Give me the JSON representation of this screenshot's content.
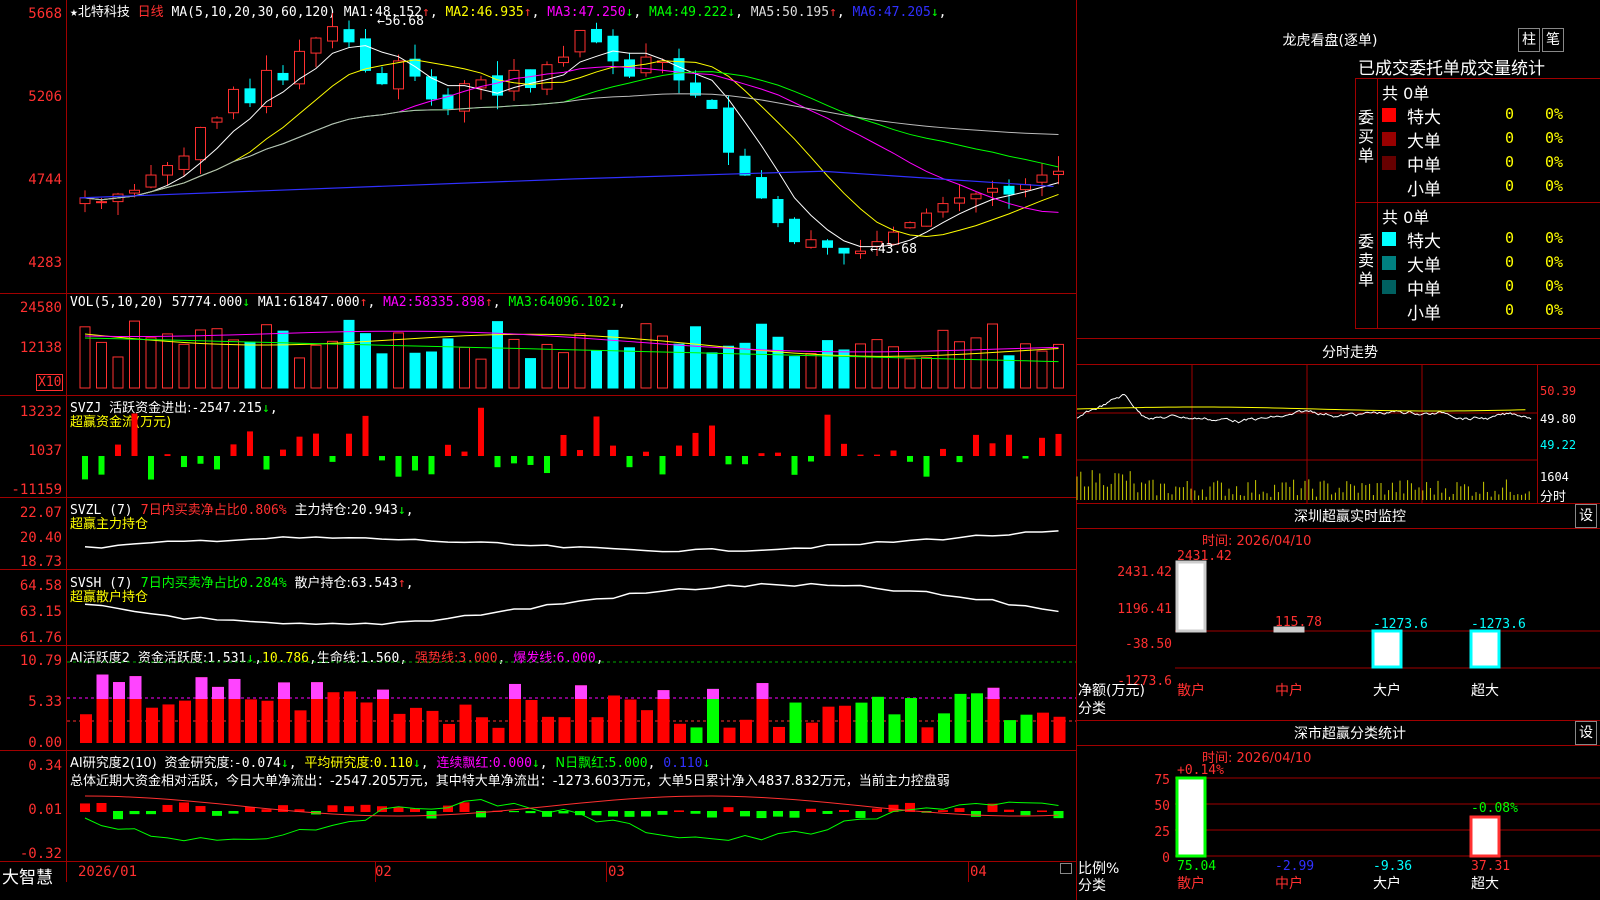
{
  "stock": {
    "star": "★",
    "name": "北特科技",
    "period": "日线"
  },
  "main": {
    "ma_params": "MA(5,10,20,30,60,120)",
    "ma": [
      {
        "label": "MA1:",
        "value": "48.152",
        "dir": "↑",
        "color": "#ffffff"
      },
      {
        "label": "MA2:",
        "value": "46.935",
        "dir": "↑",
        "color": "#ffff00"
      },
      {
        "label": "MA3:",
        "value": "47.250",
        "dir": "↓",
        "color": "#ff00ff"
      },
      {
        "label": "MA4:",
        "value": "49.222",
        "dir": "↓",
        "color": "#00ff00"
      },
      {
        "label": "MA5:",
        "value": "50.195",
        "dir": "↑",
        "color": "#dddddd"
      },
      {
        "label": "MA6:",
        "value": "47.205",
        "dir": "↓",
        "color": "#3030ff"
      }
    ],
    "y_ticks": [
      "5668",
      "5206",
      "4744",
      "4283"
    ],
    "high_mark": "56.68",
    "low_mark": "43.68"
  },
  "vol": {
    "label": "VOL(5,10,20)",
    "value": "57774.000",
    "dir": "↓",
    "ma": [
      {
        "label": "MA1:",
        "value": "61847.000",
        "dir": "↑",
        "color": "#ffffff"
      },
      {
        "label": "MA2:",
        "value": "58335.898",
        "dir": "↑",
        "color": "#ff00ff"
      },
      {
        "label": "MA3:",
        "value": "64096.102",
        "dir": "↓",
        "color": "#00ff00"
      }
    ],
    "y_ticks": [
      "24580",
      "12138"
    ],
    "unit": "X10"
  },
  "svzj": {
    "label": "SVZJ",
    "text1": "活跃资金进出:",
    "value": "-2547.215",
    "dir": "↓",
    "suffix": ",",
    "subtitle": "超赢资金流(万元)",
    "y_ticks": [
      "13232",
      "1037",
      "-11159"
    ]
  },
  "svzl": {
    "label": "SVZL (7)",
    "text1": "7日内买卖净占比",
    "v1": "0.806%",
    "text2": "主力持仓:",
    "v2": "20.943",
    "dir": "↓",
    "suffix": ",",
    "subtitle": "超赢主力持仓",
    "y_ticks": [
      "22.07",
      "20.40",
      "18.73"
    ]
  },
  "svsh": {
    "label": "SVSH (7)",
    "text1": "7日内买卖净占比",
    "v1": "0.284%",
    "text2": "散户持仓:",
    "v2": "63.543",
    "dir": "↑",
    "suffix": ",",
    "subtitle": "超赢散户持仓",
    "y_ticks": [
      "64.58",
      "63.15",
      "61.76"
    ]
  },
  "ai1": {
    "label": "AI活跃度2",
    "text1": "资金活跃度:",
    "v1": "1.531",
    "dir1": "↓",
    "v2": "10.786",
    "text3": "生命线:",
    "v3": "1.560",
    "text4": "强势线:",
    "v4": "3.000",
    "text5": "爆发线:",
    "v5": "6.000",
    "suffix": ",",
    "y_ticks": [
      "10.79",
      "5.33",
      "0.00"
    ]
  },
  "ai2": {
    "label": "AI研究度2(10)",
    "text1": "资金研究度:",
    "v1": "-0.074",
    "dir1": "↓",
    "text2": "平均研究度:",
    "v2": "0.110",
    "dir2": "↓",
    "text3": "连续飘红:",
    "v3": "0.000",
    "dir3": "↓",
    "text4": "N日飘红:",
    "v4": "5.000",
    "v5": "0.110",
    "dir5": "↓",
    "summary": "总体近期大资金相对活跃，今日大单净流出：-2547.205万元，其中特大单净流出：-1273.603万元，大单5日累计净入4837.832万元，当前主力控盘弱",
    "y_ticks": [
      "0.34",
      "0.01",
      "-0.32"
    ]
  },
  "x_axis": {
    "brand": "大智慧",
    "labels": [
      "2026/01",
      "02",
      "03",
      "04"
    ]
  },
  "right": {
    "lhb_title": "龙虎看盘(逐单)",
    "btn_zhu": "柱",
    "btn_bi": "笔",
    "sub_title": "已成交委托单成交量统计",
    "buy": {
      "side": "委买单",
      "total": "共 0单",
      "rows": [
        {
          "name": "特大",
          "count": "0",
          "pct": "0%",
          "color": "#ff0000"
        },
        {
          "name": "大单",
          "count": "0",
          "pct": "0%",
          "color": "#990000"
        },
        {
          "name": "中单",
          "count": "0",
          "pct": "0%",
          "color": "#660000"
        },
        {
          "name": "小单",
          "count": "0",
          "pct": "0%",
          "color": "#000000"
        }
      ]
    },
    "sell": {
      "side": "委卖单",
      "total": "共 0单",
      "rows": [
        {
          "name": "特大",
          "count": "0",
          "pct": "0%",
          "color": "#00ffff"
        },
        {
          "name": "大单",
          "count": "0",
          "pct": "0%",
          "color": "#008080"
        },
        {
          "name": "中单",
          "count": "0",
          "pct": "0%",
          "color": "#006060"
        },
        {
          "name": "小单",
          "count": "0",
          "pct": "0%",
          "color": "#000000"
        }
      ]
    },
    "fs_title": "分时走势",
    "fs_ticks": [
      "50.39",
      "49.80",
      "49.22"
    ],
    "fs_vol": "1604",
    "fs_vol_unit": "分时",
    "sz_title": "深圳超赢实时监控",
    "set_btn": "设",
    "sz_time": "时间: 2026/04/10",
    "sz_ticks": [
      "2431.42",
      "1196.41",
      "-38.50",
      "-1273.6"
    ],
    "sz_values": [
      "2431.42",
      "115.78",
      "-1273.6",
      "-1273.6"
    ],
    "sz_ylabel": "净额(万元)",
    "cat_label": "分类",
    "cats": [
      "散户",
      "中户",
      "大户",
      "超大"
    ],
    "ss_title": "深市超赢分类统计",
    "ss_time": "时间: 2026/04/10",
    "ss_ticks": [
      "75",
      "50",
      "25",
      "0"
    ],
    "ss_top": [
      "+0.14%",
      "-0.08%"
    ],
    "ss_ylabel": "比例%",
    "ss_values": [
      "75.04",
      "-2.99",
      "-9.36",
      "37.31"
    ]
  }
}
